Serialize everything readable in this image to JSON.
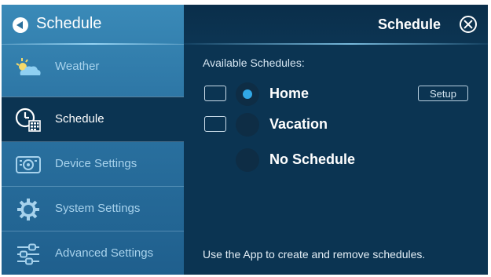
{
  "sidebar": {
    "title": "Schedule",
    "items": [
      {
        "label": "Weather",
        "icon": "weather-icon",
        "active": false
      },
      {
        "label": "Schedule",
        "icon": "schedule-icon",
        "active": true
      },
      {
        "label": "Device Settings",
        "icon": "device-settings-icon",
        "active": false
      },
      {
        "label": "System Settings",
        "icon": "gear-icon",
        "active": false
      },
      {
        "label": "Advanced Settings",
        "icon": "sliders-icon",
        "active": false
      }
    ]
  },
  "main": {
    "title": "Schedule",
    "available_label": "Available Schedules:",
    "schedules": [
      {
        "name": "Home",
        "selected": true,
        "has_checkbox": true,
        "setup_label": "Setup"
      },
      {
        "name": "Vacation",
        "selected": false,
        "has_checkbox": true
      },
      {
        "name": "No Schedule",
        "selected": false,
        "has_checkbox": false
      }
    ],
    "footer": "Use the App to create and remove schedules."
  },
  "colors": {
    "panel_bg": "#0b3452",
    "sidebar_top": "#3a8ab8",
    "sidebar_bottom": "#1f5f8d",
    "accent": "#31a8e6",
    "inactive_text": "#a7d2ec"
  }
}
